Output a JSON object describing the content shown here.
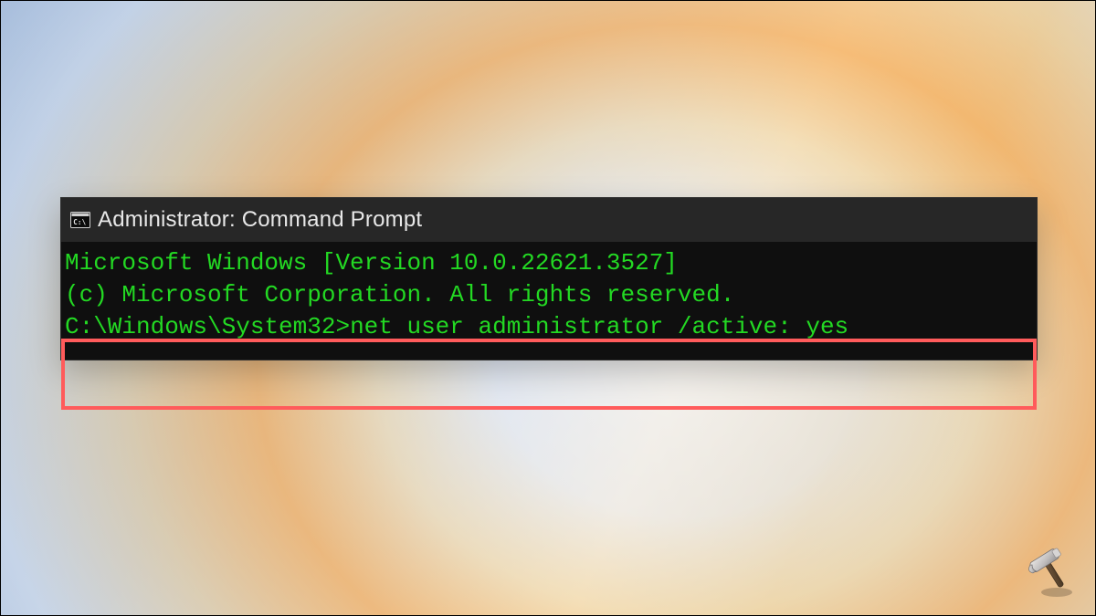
{
  "window": {
    "title": "Administrator: Command Prompt",
    "icon_label": "cmd-icon"
  },
  "terminal": {
    "line1": "Microsoft Windows [Version 10.0.22621.3527]",
    "line2": "(c) Microsoft Corporation. All rights reserved.",
    "blank": "",
    "prompt_path": "C:\\Windows\\System32>",
    "command": "net user administrator /active: yes"
  },
  "colors": {
    "terminal_text": "#23d923",
    "highlight_border": "#ff5b5b",
    "titlebar_bg": "#272727",
    "terminal_bg": "#0f0f0f"
  },
  "watermark": {
    "label": "hammer-icon"
  }
}
